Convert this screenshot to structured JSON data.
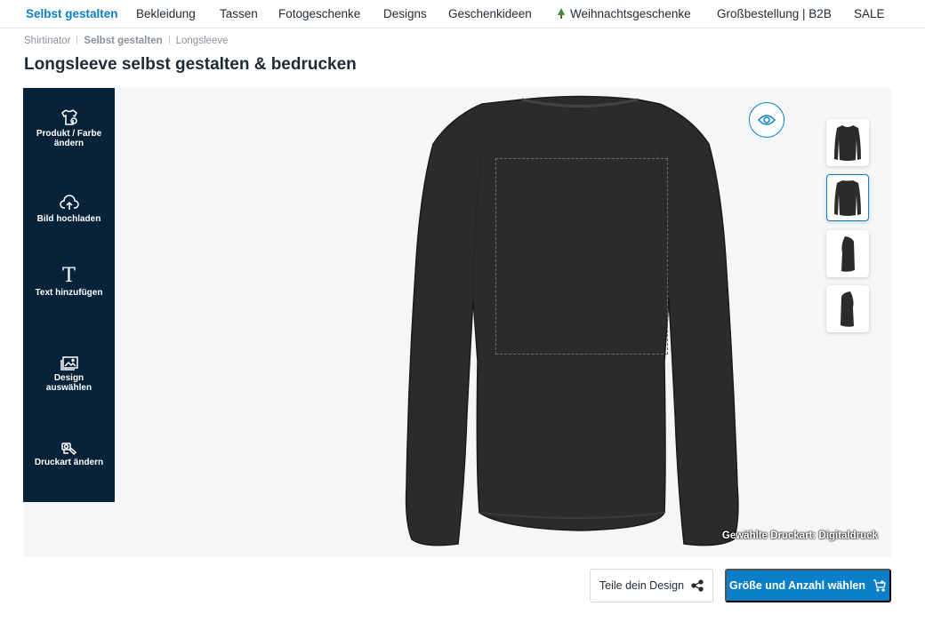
{
  "nav": {
    "items": [
      {
        "label": "Selbst gestalten",
        "active": true
      },
      {
        "label": "Bekleidung"
      },
      {
        "label": "Tassen"
      },
      {
        "label": "Fotogeschenke"
      },
      {
        "label": "Designs"
      },
      {
        "label": "Geschenkideen"
      },
      {
        "label": "Weihnachtsgeschenke",
        "icon": "christmas-tree-icon"
      },
      {
        "label": "Großbestellung | B2B"
      },
      {
        "label": "SALE"
      }
    ]
  },
  "breadcrumb": [
    "Shirtinator",
    "Selbst gestalten",
    "Longsleeve"
  ],
  "page_title": "Longsleeve selbst gestalten & bedrucken",
  "toolbar": {
    "tools": [
      {
        "label": "Produkt / Farbe ändern",
        "icon": "shirt-swap-icon"
      },
      {
        "label": "Bild hochladen",
        "icon": "cloud-upload-icon"
      },
      {
        "label": "Text hinzufügen",
        "icon": "text-icon",
        "glyph": "T"
      },
      {
        "label": "Design auswählen",
        "icon": "image-gallery-icon"
      },
      {
        "label": "Druckart ändern",
        "icon": "print-method-icon"
      }
    ]
  },
  "canvas": {
    "print_type_text": "Gewählte Druckart: Digitaldruck",
    "thumbnails": [
      "front",
      "back",
      "left-side",
      "right-side"
    ],
    "active_thumbnail": "back",
    "product_color": "#2b2b2b"
  },
  "actions": {
    "share_label": "Teile dein Design",
    "order_label": "Größe und Anzahl wählen"
  },
  "colors": {
    "accent": "#0a7fc7",
    "toolbar_bg": "#07233a"
  }
}
